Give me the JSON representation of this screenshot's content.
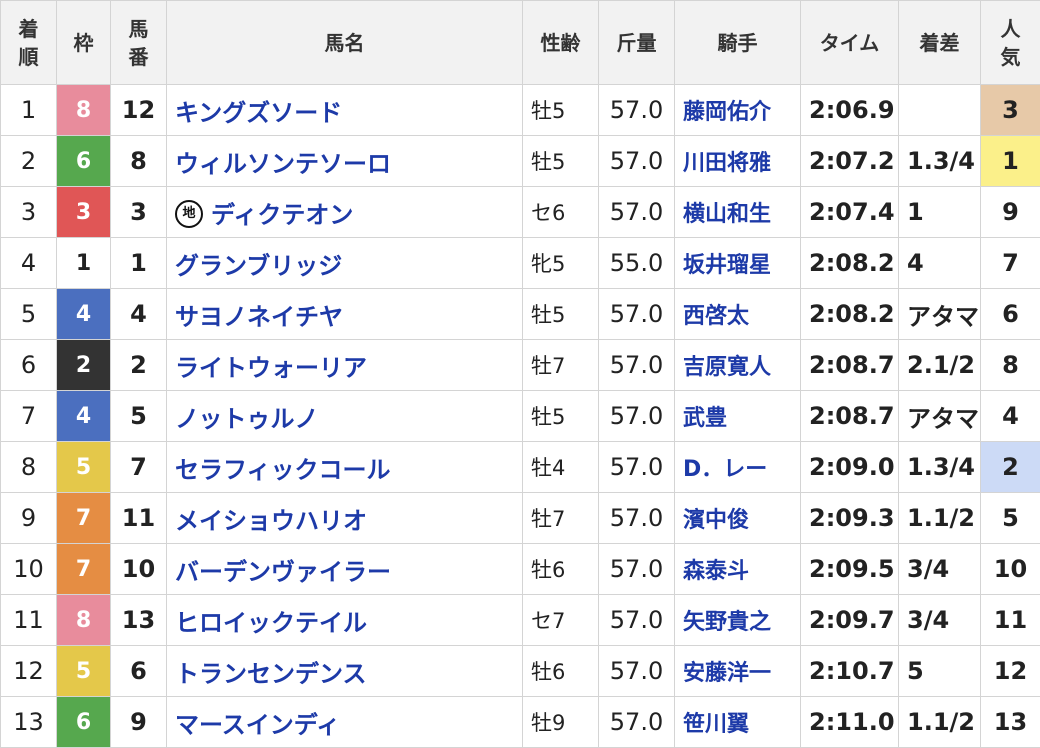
{
  "headers": {
    "rank": "着\n順",
    "frame": "枠",
    "number": "馬\n番",
    "horse": "馬名",
    "sex_age": "性齢",
    "weight": "斤量",
    "jockey": "騎手",
    "time": "タイム",
    "margin": "着差",
    "popularity": "人\n気"
  },
  "local_badge": "地",
  "frame_colors": {
    "1": {
      "bg": "#ffffff",
      "fg": "#222222"
    },
    "2": {
      "bg": "#333333",
      "fg": "#ffffff"
    },
    "3": {
      "bg": "#e05656",
      "fg": "#ffffff"
    },
    "4": {
      "bg": "#4b6fbf",
      "fg": "#ffffff"
    },
    "5": {
      "bg": "#e4c84a",
      "fg": "#ffffff"
    },
    "6": {
      "bg": "#56a84e",
      "fg": "#ffffff"
    },
    "7": {
      "bg": "#e58d43",
      "fg": "#ffffff"
    },
    "8": {
      "bg": "#e88c9c",
      "fg": "#ffffff"
    }
  },
  "popularity_highlight": {
    "1": "#fbf08a",
    "2": "#ccdaf6",
    "3": "#e7c9a8"
  },
  "rows": [
    {
      "rank": "1",
      "frame": "8",
      "number": "12",
      "horse": "キングズソード",
      "local": false,
      "sex_age": "牡5",
      "weight": "57.0",
      "jockey": "藤岡佑介",
      "time": "2:06.9",
      "margin": "",
      "popularity": "3"
    },
    {
      "rank": "2",
      "frame": "6",
      "number": "8",
      "horse": "ウィルソンテソーロ",
      "local": false,
      "sex_age": "牡5",
      "weight": "57.0",
      "jockey": "川田将雅",
      "time": "2:07.2",
      "margin": "1.3/4",
      "popularity": "1"
    },
    {
      "rank": "3",
      "frame": "3",
      "number": "3",
      "horse": "ディクテオン",
      "local": true,
      "sex_age": "セ6",
      "weight": "57.0",
      "jockey": "横山和生",
      "time": "2:07.4",
      "margin": "1",
      "popularity": "9"
    },
    {
      "rank": "4",
      "frame": "1",
      "number": "1",
      "horse": "グランブリッジ",
      "local": false,
      "sex_age": "牝5",
      "weight": "55.0",
      "jockey": "坂井瑠星",
      "time": "2:08.2",
      "margin": "4",
      "popularity": "7"
    },
    {
      "rank": "5",
      "frame": "4",
      "number": "4",
      "horse": "サヨノネイチヤ",
      "local": false,
      "sex_age": "牡5",
      "weight": "57.0",
      "jockey": "西啓太",
      "time": "2:08.2",
      "margin": "アタマ",
      "popularity": "6"
    },
    {
      "rank": "6",
      "frame": "2",
      "number": "2",
      "horse": "ライトウォーリア",
      "local": false,
      "sex_age": "牡7",
      "weight": "57.0",
      "jockey": "吉原寛人",
      "time": "2:08.7",
      "margin": "2.1/2",
      "popularity": "8"
    },
    {
      "rank": "7",
      "frame": "4",
      "number": "5",
      "horse": "ノットゥルノ",
      "local": false,
      "sex_age": "牡5",
      "weight": "57.0",
      "jockey": "武豊",
      "time": "2:08.7",
      "margin": "アタマ",
      "popularity": "4"
    },
    {
      "rank": "8",
      "frame": "5",
      "number": "7",
      "horse": "セラフィックコール",
      "local": false,
      "sex_age": "牡4",
      "weight": "57.0",
      "jockey": "D．レー",
      "time": "2:09.0",
      "margin": "1.3/4",
      "popularity": "2"
    },
    {
      "rank": "9",
      "frame": "7",
      "number": "11",
      "horse": "メイショウハリオ",
      "local": false,
      "sex_age": "牡7",
      "weight": "57.0",
      "jockey": "濱中俊",
      "time": "2:09.3",
      "margin": "1.1/2",
      "popularity": "5"
    },
    {
      "rank": "10",
      "frame": "7",
      "number": "10",
      "horse": "バーデンヴァイラー",
      "local": false,
      "sex_age": "牡6",
      "weight": "57.0",
      "jockey": "森泰斗",
      "time": "2:09.5",
      "margin": "3/4",
      "popularity": "10"
    },
    {
      "rank": "11",
      "frame": "8",
      "number": "13",
      "horse": "ヒロイックテイル",
      "local": false,
      "sex_age": "セ7",
      "weight": "57.0",
      "jockey": "矢野貴之",
      "time": "2:09.7",
      "margin": "3/4",
      "popularity": "11"
    },
    {
      "rank": "12",
      "frame": "5",
      "number": "6",
      "horse": "トランセンデンス",
      "local": false,
      "sex_age": "牡6",
      "weight": "57.0",
      "jockey": "安藤洋一",
      "time": "2:10.7",
      "margin": "5",
      "popularity": "12"
    },
    {
      "rank": "13",
      "frame": "6",
      "number": "9",
      "horse": "マースインディ",
      "local": false,
      "sex_age": "牡9",
      "weight": "57.0",
      "jockey": "笹川翼",
      "time": "2:11.0",
      "margin": "1.1/2",
      "popularity": "13"
    }
  ]
}
